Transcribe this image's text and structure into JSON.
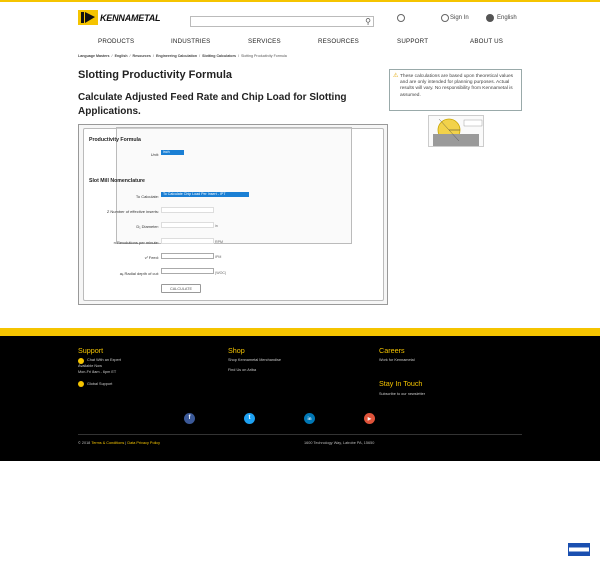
{
  "header": {
    "logo_text": "KENNAMETAL",
    "search_placeholder": "",
    "sign_in": "Sign In",
    "language": "English"
  },
  "nav": {
    "items": [
      "PRODUCTS",
      "INDUSTRIES",
      "SERVICES",
      "RESOURCES",
      "SUPPORT",
      "ABOUT US"
    ]
  },
  "breadcrumb": {
    "items": [
      "Language Masters",
      "English",
      "Resources",
      "Engineering Calculation",
      "Slotting Calculators",
      "Slotting Productivity Formula"
    ]
  },
  "page": {
    "title": "Slotting Productivity Formula",
    "subtitle": "Calculate Adjusted Feed Rate and Chip Load for Slotting Applications.",
    "notice": "These calculations are based upon theoretical values and are only intended for planning purposes. Actual results will vary. No responsibility from Kennametal is assumed."
  },
  "calculator": {
    "productivity_title": "Productivity Formula",
    "unit_label": "Unit:",
    "unit_value": "inch",
    "nomenclature_title": "Slot Mill Nomenclature",
    "to_calculate_label": "To Calculate:",
    "to_calculate_value": "To Calculate Chip Load Per Insert - IPT",
    "inserts_label": "Z Number of effective inserts:",
    "diameter_label": "D₁ Diameter:",
    "diameter_unit": "in",
    "rpm_label": "n Revolutions per minute:",
    "rpm_unit": "RPM",
    "feed_label": "vᶠ Feed:",
    "feed_unit": "IPM",
    "radial_label": "aₑ Radial depth of cut:",
    "radial_unit": "(WOC)",
    "calculate_button": "CALCULATE"
  },
  "footer": {
    "support_title": "Support",
    "support_chat": "Chat With an Expert",
    "support_available": "Available Now",
    "support_hours": "Mon-Fri 8am - 6pm ET",
    "support_global": "Global Support",
    "shop_title": "Shop",
    "shop_merch": "Shop Kennametal Merchandise",
    "shop_ariba": "Find Us on Ariba",
    "careers_title": "Careers",
    "careers_work": "Work for Kennametal",
    "stay_title": "Stay In Touch",
    "stay_sub": "Subscribe to our newsletter",
    "copyright": "© 2018",
    "terms": "Terms & Conditions",
    "privacy": "Data Privacy Policy",
    "address": "1600 Technology Way, Latrobe PA, 15650"
  },
  "social": [
    "f",
    "t",
    "in",
    "▶"
  ],
  "colors": {
    "accent": "#f5c400",
    "select": "#1a7fd4"
  }
}
